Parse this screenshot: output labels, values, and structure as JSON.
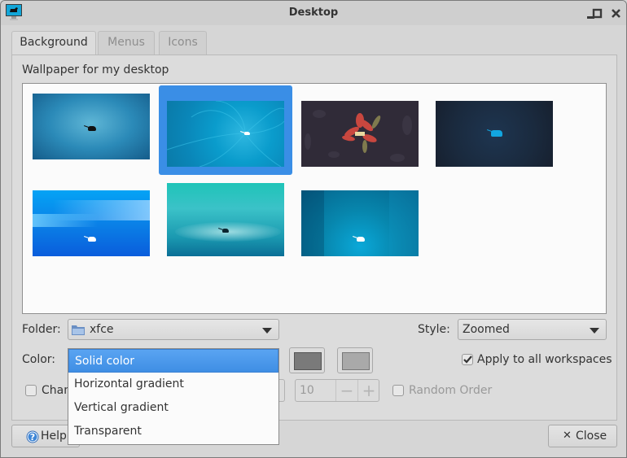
{
  "window": {
    "title": "Desktop",
    "controls": [
      "minimize-icon",
      "maximize-icon",
      "close-icon"
    ]
  },
  "tabs": [
    {
      "label": "Background",
      "active": true
    },
    {
      "label": "Menus",
      "active": false
    },
    {
      "label": "Icons",
      "active": false
    }
  ],
  "background": {
    "section_label": "Wallpaper for my desktop",
    "wallpapers": [
      {
        "name": "xfce-blue-radial",
        "selected": false
      },
      {
        "name": "xfce-flower-spiral",
        "selected": true
      },
      {
        "name": "xfce-dark-floral",
        "selected": false
      },
      {
        "name": "xfce-dark-noise",
        "selected": false
      },
      {
        "name": "xfce-blue-stripes",
        "selected": false
      },
      {
        "name": "xfce-teal-wave",
        "selected": false
      },
      {
        "name": "xfce-teal-columns",
        "selected": false
      }
    ],
    "folder_label": "Folder:",
    "folder_value": "xfce",
    "style_label": "Style:",
    "style_value": "Zoomed",
    "color_label": "Color:",
    "color_options": [
      "Solid color",
      "Horizontal gradient",
      "Vertical gradient",
      "Transparent"
    ],
    "color_selected": "Solid color",
    "color1": "#7a7a7a",
    "color2": "#a9a9a9",
    "apply_all_label": "Apply to all workspaces",
    "apply_all_checked": true,
    "change_label": "Chan",
    "change_checked": false,
    "interval_value": "10",
    "spin_minus": "−",
    "spin_plus": "+",
    "random_order_label": "Random Order",
    "random_order_checked": false
  },
  "footer": {
    "help_label": "Help",
    "close_label": "Close",
    "close_glyph": "✕"
  },
  "colors": {
    "accent": "#3a8ee6",
    "window_bg": "#d6d6d6"
  }
}
